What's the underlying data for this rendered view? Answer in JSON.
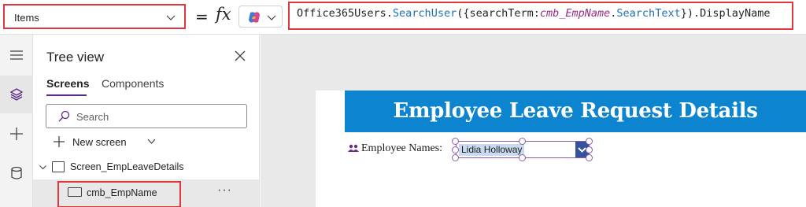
{
  "formula_bar": {
    "property": "Items",
    "equals": "=",
    "fx": "fx",
    "formula_tokens": {
      "obj": "Office365Users.",
      "fn": "SearchUser",
      "open": "({",
      "param": "searchTerm:",
      "ctrl": "cmb_EmpName",
      "dot": ".",
      "prop": "SearchText",
      "close": "}).DisplayName"
    }
  },
  "rail": {
    "icons": [
      "hamburger-menu-icon",
      "layers-icon",
      "plus-icon",
      "database-icon"
    ]
  },
  "tree_view": {
    "title": "Tree view",
    "tabs": [
      {
        "label": "Screens",
        "active": true
      },
      {
        "label": "Components",
        "active": false
      }
    ],
    "search_placeholder": "Search",
    "new_screen_label": "New screen",
    "screen_name": "Screen_EmpLeaveDetails",
    "control_name": "cmb_EmpName",
    "more_label": "···"
  },
  "canvas": {
    "header_title": "Employee Leave Request Details",
    "employee_label": "Employee Names:",
    "selected_employee": "Lidia Holloway"
  },
  "colors": {
    "highlight_border": "#e0373f",
    "header_blue": "#0c84d0",
    "selection_purple": "#8e5bb2",
    "tab_underline": "#5b2a86"
  }
}
